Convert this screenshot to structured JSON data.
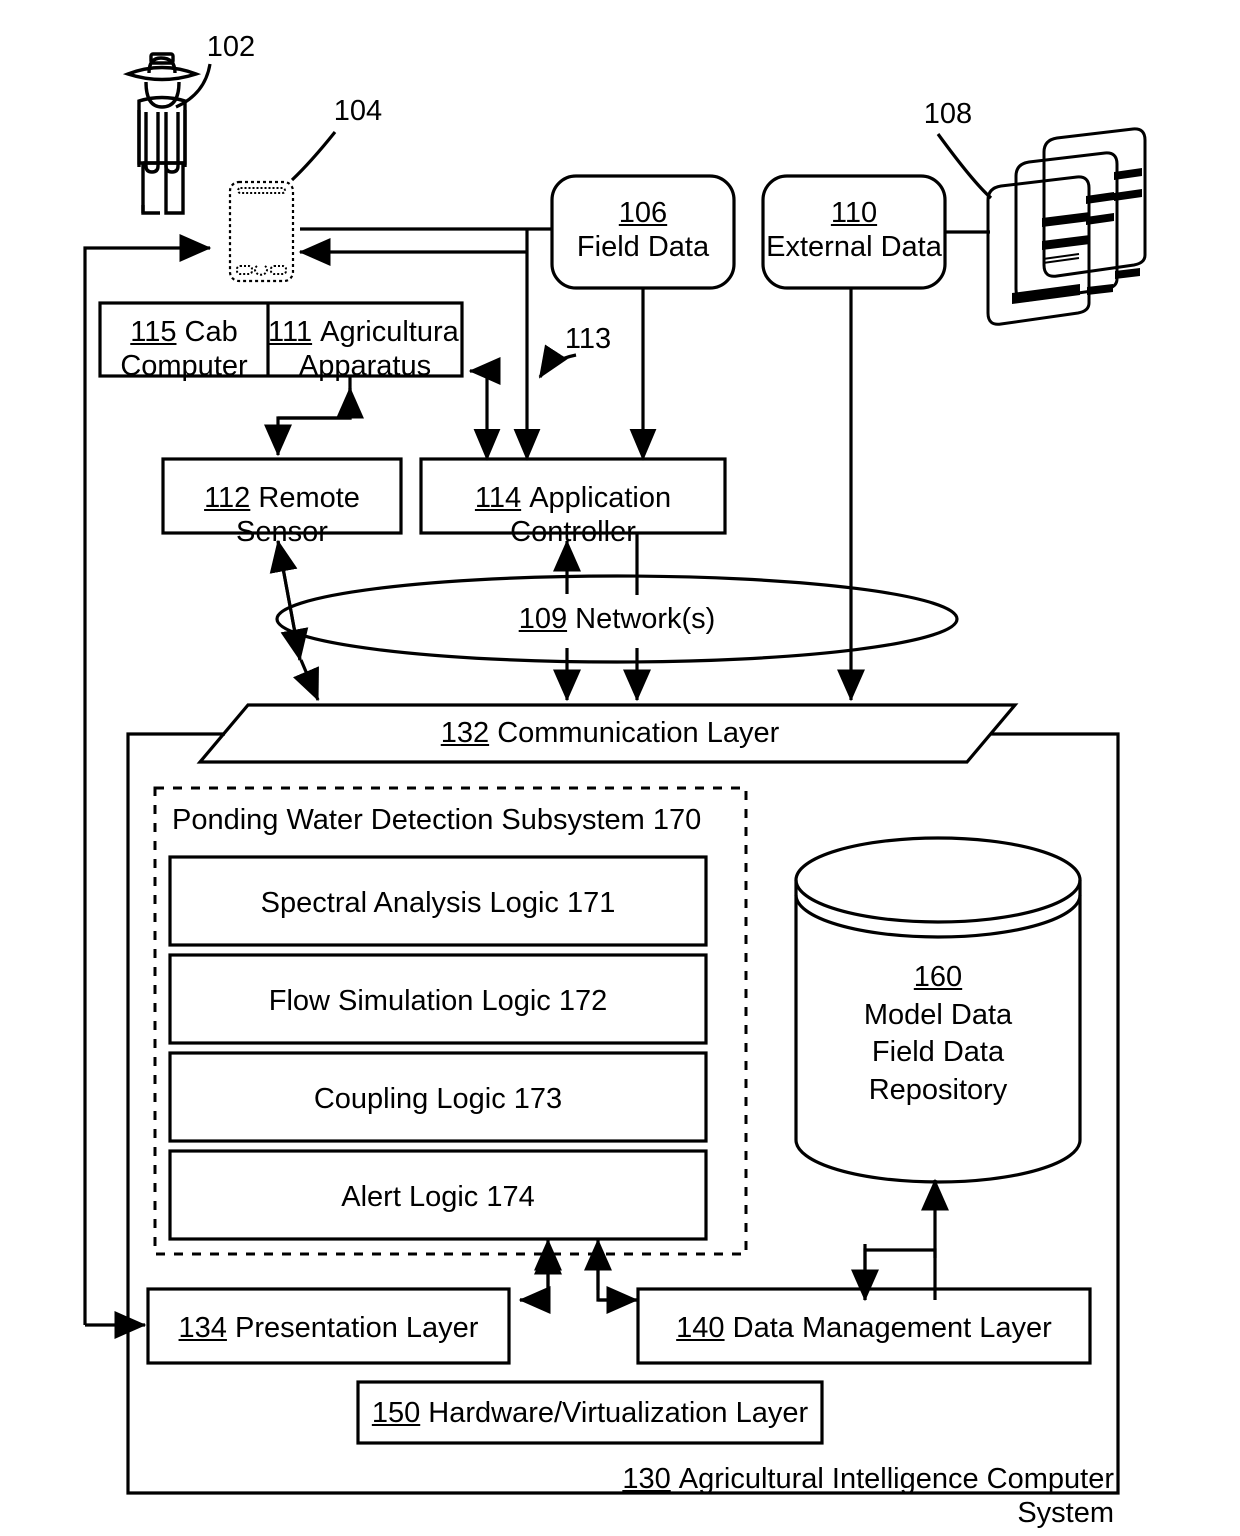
{
  "figure": {
    "type": "patent-system-block-diagram",
    "title": "Agricultural Intelligence Computer System with Ponding Water Detection Subsystem"
  },
  "actors": {
    "farmer": {
      "ref": "102",
      "icon": "farmer-person-icon"
    },
    "mobile_device": {
      "ref": "104",
      "icon": "mobile-phone-icon"
    },
    "servers": {
      "ref": "108",
      "icon": "server-stack-icon"
    }
  },
  "data_sources": [
    {
      "ref": "106",
      "label": "Field Data"
    },
    {
      "ref": "110",
      "label": "External Data"
    }
  ],
  "callouts": [
    {
      "ref": "102"
    },
    {
      "ref": "104"
    },
    {
      "ref": "108"
    },
    {
      "ref": "113"
    }
  ],
  "equipment": {
    "cab_computer": {
      "ref": "115",
      "label": "Cab\nComputer",
      "line1": "Cab",
      "line2": "Computer"
    },
    "agricultural_apparatus": {
      "ref": "111",
      "label": "Agricultural Apparatus",
      "line1": "Agricultural",
      "line2": "Apparatus"
    },
    "remote_sensor": {
      "ref": "112",
      "label": "Remote Sensor"
    },
    "application_controller": {
      "ref": "114",
      "label": "Application Controller"
    }
  },
  "network": {
    "ref": "109",
    "label": "Network(s)"
  },
  "system": {
    "ref": "130",
    "label": "Agricultural Intelligence Computer System",
    "communication_layer": {
      "ref": "132",
      "label": "Communication Layer"
    },
    "presentation_layer": {
      "ref": "134",
      "label": "Presentation Layer"
    },
    "data_management_layer": {
      "ref": "140",
      "label": "Data Management Layer"
    },
    "hardware_layer": {
      "ref": "150",
      "label": "Hardware/Virtualization Layer"
    }
  },
  "subsystem": {
    "title": "Ponding Water Detection Subsystem 170",
    "ref": "170",
    "modules": [
      {
        "ref": "171",
        "label": "Spectral Analysis Logic 171"
      },
      {
        "ref": "172",
        "label": "Flow Simulation Logic 172"
      },
      {
        "ref": "173",
        "label": "Coupling Logic 173"
      },
      {
        "ref": "174",
        "label": "Alert Logic 174"
      }
    ]
  },
  "repository": {
    "ref": "160",
    "line1": "Model Data",
    "line2": "Field Data",
    "line3": "Repository"
  },
  "colors": {
    "stroke": "#000000",
    "background": "#ffffff"
  }
}
